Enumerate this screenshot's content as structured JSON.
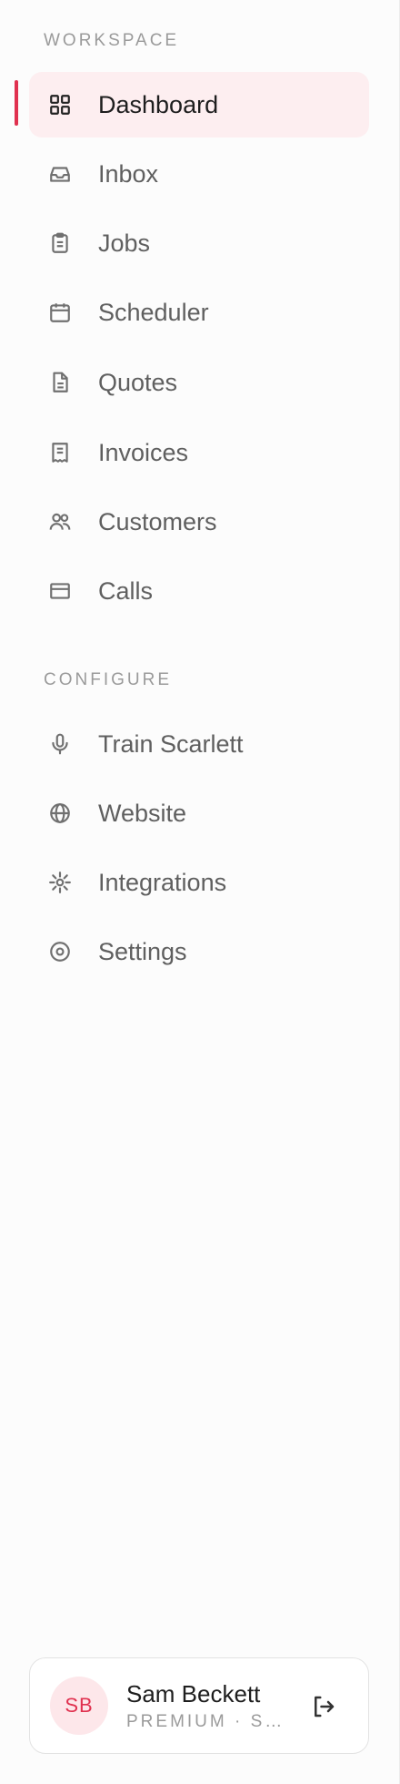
{
  "sidebar": {
    "workspace_label": "WORKSPACE",
    "configure_label": "CONFIGURE",
    "workspace_items": [
      {
        "label": "Dashboard",
        "icon": "grid-icon",
        "active": true
      },
      {
        "label": "Inbox",
        "icon": "inbox-icon"
      },
      {
        "label": "Jobs",
        "icon": "clipboard-icon"
      },
      {
        "label": "Scheduler",
        "icon": "calendar-icon"
      },
      {
        "label": "Quotes",
        "icon": "document-icon"
      },
      {
        "label": "Invoices",
        "icon": "receipt-icon"
      },
      {
        "label": "Customers",
        "icon": "users-icon"
      },
      {
        "label": "Calls",
        "icon": "panel-icon"
      }
    ],
    "configure_items": [
      {
        "label": "Train Scarlett",
        "icon": "microphone-icon"
      },
      {
        "label": "Website",
        "icon": "globe-icon"
      },
      {
        "label": "Integrations",
        "icon": "spark-icon"
      },
      {
        "label": "Settings",
        "icon": "target-icon"
      }
    ],
    "accent_color": "#e0314f"
  },
  "profile": {
    "initials": "SB",
    "name": "Sam Beckett",
    "plan": "PREMIUM · S…"
  }
}
